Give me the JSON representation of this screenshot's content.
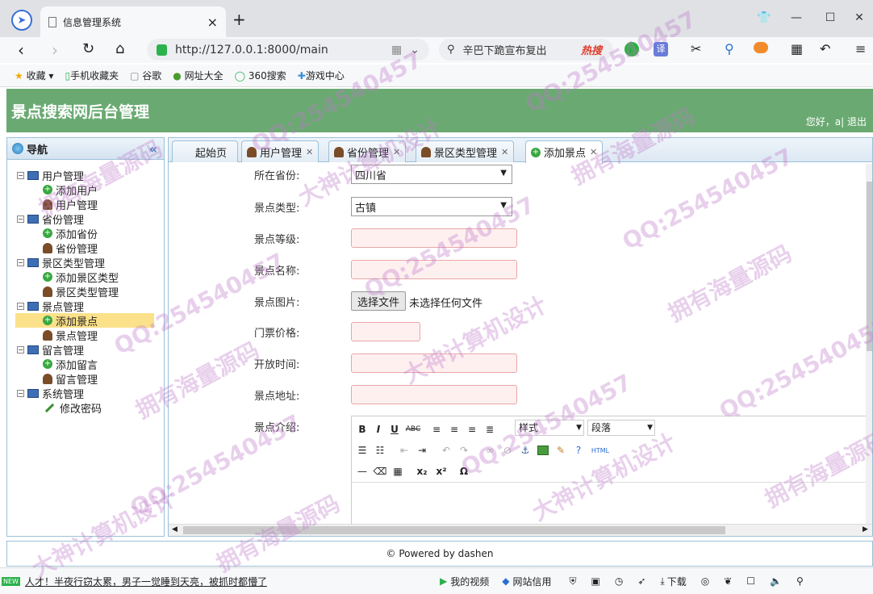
{
  "browser": {
    "tab_title": "信息管理系统",
    "tab_close": "×",
    "new_tab": "+",
    "url": "http://127.0.0.1:8000/main",
    "search_text": "辛巴下跪宣布复出",
    "hot_label": "热搜",
    "bookmarks": [
      "收藏",
      "手机收藏夹",
      "谷歌",
      "网址大全",
      "360搜索",
      "游戏中心"
    ]
  },
  "app": {
    "title": "景点搜索网后台管理",
    "greeting": "您好，a| 退出"
  },
  "sidebar": {
    "title": "导航",
    "collapse": "«",
    "groups": [
      {
        "label": "用户管理",
        "items": [
          "添加用户",
          "用户管理"
        ]
      },
      {
        "label": "省份管理",
        "items": [
          "添加省份",
          "省份管理"
        ]
      },
      {
        "label": "景区类型管理",
        "items": [
          "添加景区类型",
          "景区类型管理"
        ]
      },
      {
        "label": "景点管理",
        "items": [
          "添加景点",
          "景点管理"
        ]
      },
      {
        "label": "留言管理",
        "items": [
          "添加留言",
          "留言管理"
        ]
      },
      {
        "label": "系统管理",
        "items": [
          "修改密码"
        ]
      }
    ]
  },
  "tabs": [
    "起始页",
    "用户管理",
    "省份管理",
    "景区类型管理",
    "添加景点"
  ],
  "form": {
    "province_label": "所在省份:",
    "province_value": "四川省",
    "type_label": "景点类型:",
    "type_value": "古镇",
    "level_label": "景点等级:",
    "name_label": "景点名称:",
    "image_label": "景点图片:",
    "file_button": "选择文件",
    "file_status": "未选择任何文件",
    "price_label": "门票价格:",
    "hours_label": "开放时间:",
    "address_label": "景点地址:",
    "intro_label": "景点介绍:",
    "editor_style": "样式",
    "editor_paragraph": "段落"
  },
  "footer": "© Powered by dashen",
  "status": {
    "news_badge": "NEW",
    "news_text": "人才！半夜行窃太累，男子一觉睡到天亮，被抓时都懵了",
    "items": [
      "我的视频",
      "网站信用",
      "下载"
    ]
  },
  "watermarks": [
    "QQ:254540457",
    "拥有海量源码",
    "大神计算机设计"
  ]
}
